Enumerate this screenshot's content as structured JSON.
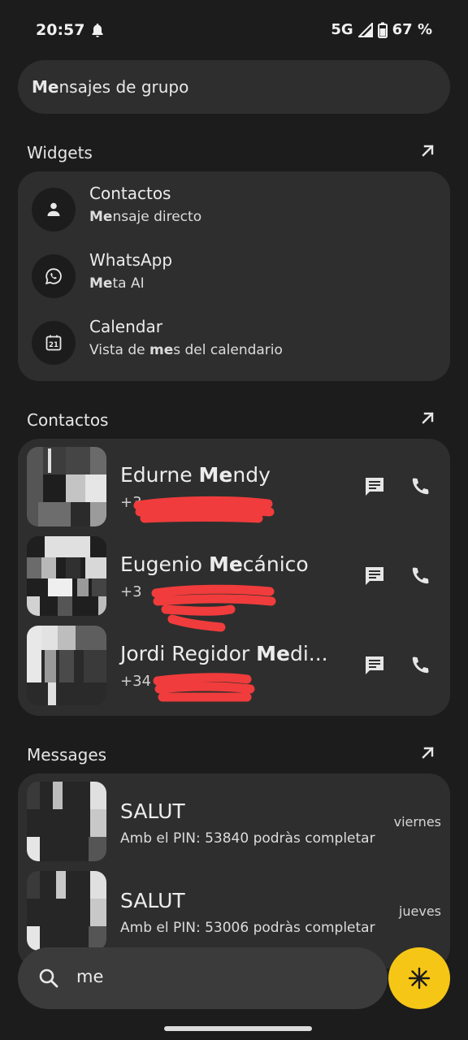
{
  "status": {
    "time": "20:57",
    "network": "5G",
    "battery": "67 %"
  },
  "suggestion": {
    "bold": "Me",
    "rest": "nsajes de grupo"
  },
  "widgets": {
    "title": "Widgets",
    "items": [
      {
        "icon": "contacts-icon",
        "title": "Contactos",
        "sub_pre": "",
        "sub_bold": "Me",
        "sub_post": "nsaje directo"
      },
      {
        "icon": "whatsapp-icon",
        "title": "WhatsApp",
        "sub_pre": "",
        "sub_bold": "Me",
        "sub_post": "ta AI"
      },
      {
        "icon": "calendar-icon",
        "icon_text": "21",
        "title": "Calendar",
        "sub_pre": "Vista de ",
        "sub_bold": "me",
        "sub_post": "s del calendario"
      }
    ]
  },
  "contacts": {
    "title": "Contactos",
    "items": [
      {
        "name_pre": "Edurne ",
        "name_bold": "Me",
        "name_post": "ndy",
        "number": "+3"
      },
      {
        "name_pre": "Eugenio ",
        "name_bold": "Me",
        "name_post": "cánico",
        "number": "+3"
      },
      {
        "name_pre": "Jordi Regidor ",
        "name_bold": "Me",
        "name_post": "di...",
        "number": "+34"
      }
    ]
  },
  "messages": {
    "title": "Messages",
    "items": [
      {
        "title": "SALUT",
        "snippet": "Amb el PIN: 53840  podràs completar",
        "date": "viernes"
      },
      {
        "title": "SALUT",
        "snippet": "Amb el PIN: 53006  podràs completar",
        "date": "jueves"
      }
    ]
  },
  "search": {
    "query": "me"
  },
  "colors": {
    "background": "#1c1c1c",
    "card": "#2e2e2e",
    "fab": "#f6c616",
    "redaction": "#f03c3c"
  }
}
